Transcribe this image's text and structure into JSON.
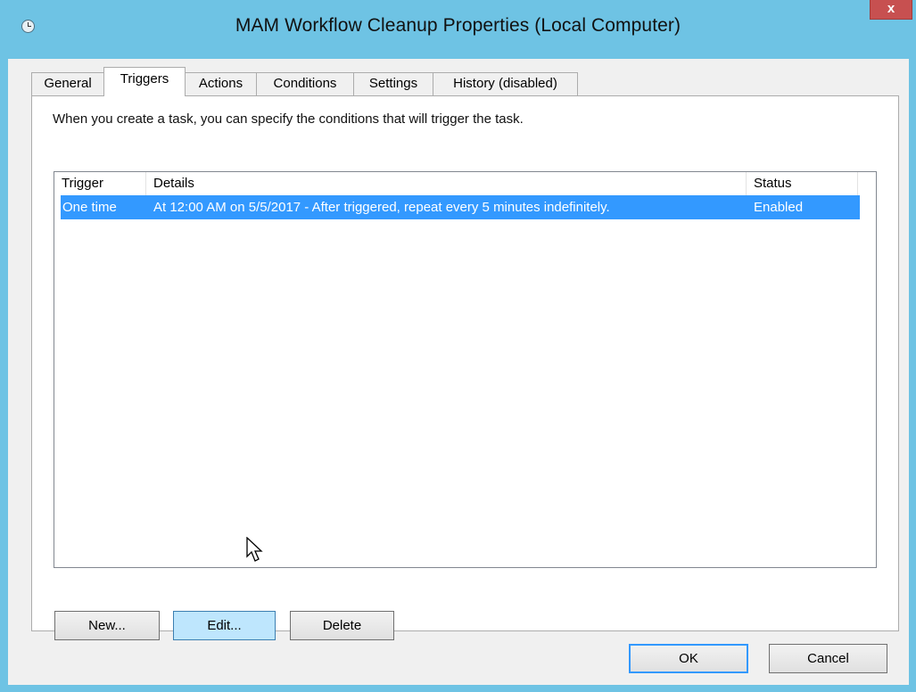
{
  "window": {
    "title": "MAM Workflow Cleanup Properties (Local Computer)",
    "close_label": "x"
  },
  "tabs": [
    {
      "label": "General",
      "active": false
    },
    {
      "label": "Triggers",
      "active": true
    },
    {
      "label": "Actions",
      "active": false
    },
    {
      "label": "Conditions",
      "active": false
    },
    {
      "label": "Settings",
      "active": false
    },
    {
      "label": "History (disabled)",
      "active": false
    }
  ],
  "panel": {
    "description": "When you create a task, you can specify the conditions that will trigger the task."
  },
  "list": {
    "columns": [
      "Trigger",
      "Details",
      "Status"
    ],
    "rows": [
      {
        "trigger": "One time",
        "details": "At 12:00 AM on 5/5/2017 - After triggered, repeat every 5 minutes indefinitely.",
        "status": "Enabled",
        "selected": true
      }
    ]
  },
  "buttons": {
    "new": "New...",
    "edit": "Edit...",
    "delete": "Delete",
    "ok": "OK",
    "cancel": "Cancel"
  },
  "colors": {
    "titlebar": "#6ec3e4",
    "selection": "#3399ff",
    "close": "#c75050"
  }
}
